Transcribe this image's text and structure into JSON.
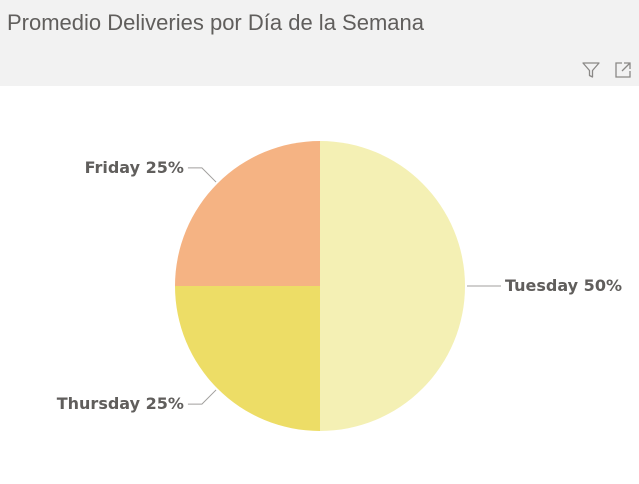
{
  "header": {
    "title": "Promedio Deliveries por Día de la Semana",
    "filter_icon": "filter-icon",
    "focus_icon": "focus-mode-icon"
  },
  "colors": {
    "header_bg": "#f2f2f2",
    "text": "#605e5c",
    "connector": "#a19f9d"
  },
  "chart_data": {
    "type": "pie",
    "title": "Promedio Deliveries por Día de la Semana",
    "categories": [
      "Tuesday",
      "Thursday",
      "Friday"
    ],
    "values": [
      50,
      25,
      25
    ],
    "labels": [
      "Tuesday 50%",
      "Thursday 25%",
      "Friday 25%"
    ],
    "colors": [
      "#f4f0b4",
      "#eddd66",
      "#f5b383"
    ],
    "label_positions": [
      "bottom-right",
      "bottom-left",
      "top-left"
    ]
  }
}
